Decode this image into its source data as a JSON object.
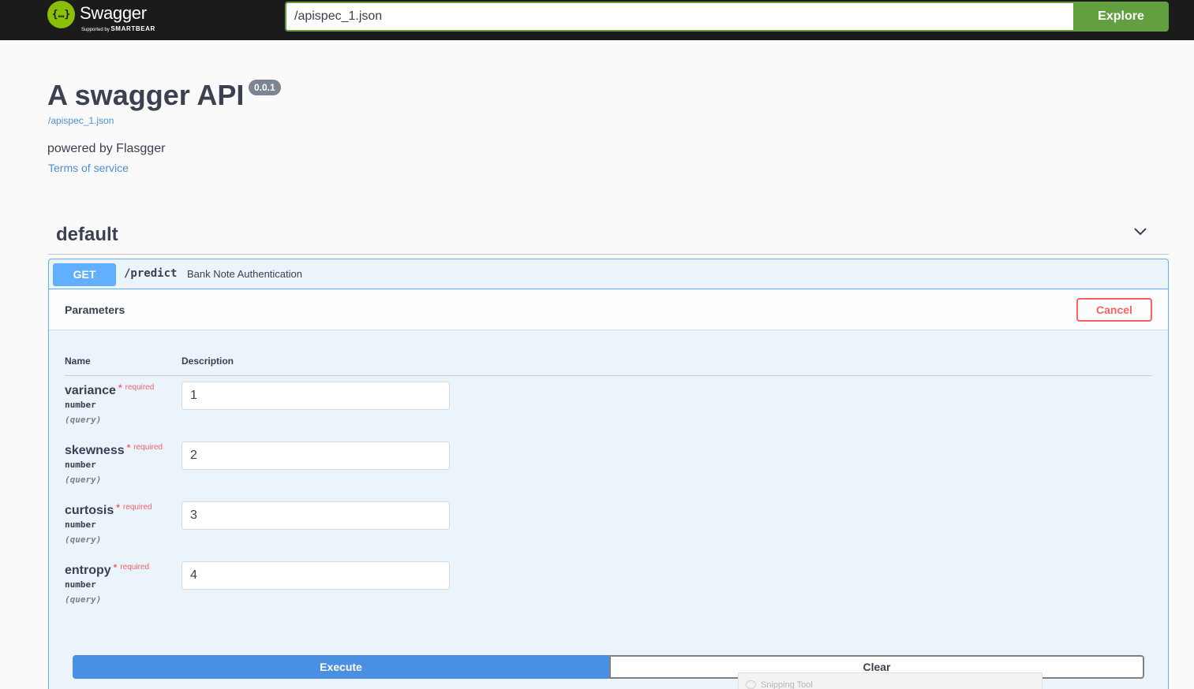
{
  "topbar": {
    "logo_glyph": "{…}",
    "logo_text": "Swagger",
    "logo_sub_prefix": "Supported by",
    "logo_sub_brand": "SMARTBEAR",
    "url_value": "/apispec_1.json",
    "explore_label": "Explore",
    "accent_color": "#62a03f"
  },
  "info": {
    "title": "A swagger API",
    "version": "0.0.1",
    "spec_url": "/apispec_1.json",
    "description": "powered by Flasgger",
    "terms_label": "Terms of service"
  },
  "tag": {
    "name": "default",
    "icon": "chevron-down-icon"
  },
  "operation": {
    "method": "GET",
    "path": "/predict",
    "summary": "Bank Note Authentication",
    "method_color": "#61affe"
  },
  "parameters": {
    "title": "Parameters",
    "cancel_label": "Cancel",
    "col_name": "Name",
    "col_description": "Description",
    "star": "*",
    "required_label": "required",
    "items": [
      {
        "name": "variance",
        "type": "number",
        "in": "(query)",
        "value": "1"
      },
      {
        "name": "skewness",
        "type": "number",
        "in": "(query)",
        "value": "2"
      },
      {
        "name": "curtosis",
        "type": "number",
        "in": "(query)",
        "value": "3"
      },
      {
        "name": "entropy",
        "type": "number",
        "in": "(query)",
        "value": "4"
      }
    ]
  },
  "actions": {
    "execute_label": "Execute",
    "clear_label": "Clear"
  },
  "overlay": {
    "snipping_tool_label": "Snipping Tool"
  }
}
